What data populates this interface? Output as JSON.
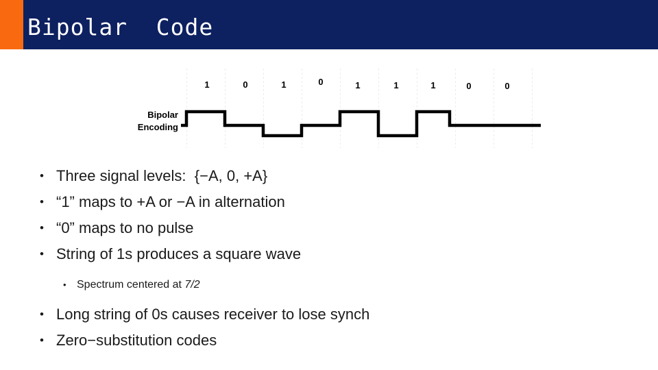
{
  "slide": {
    "title": "Bipolar  Code",
    "accent_color": "#f96a10",
    "header_color": "#0d2060",
    "title_color": "#ffffff"
  },
  "diagram": {
    "axis_label_line1": "Bipolar",
    "axis_label_line2": "Encoding",
    "bits": [
      "1",
      "0",
      "1",
      "0",
      "1",
      "1",
      "1",
      "0",
      "0"
    ],
    "signal": {
      "description": "bipolar AMI waveform",
      "levels": [
        "+A",
        "0",
        "-A",
        "0",
        "+A",
        "-A",
        "+A",
        "0",
        "0"
      ]
    }
  },
  "body": {
    "bullets": [
      "Three signal levels:  {−A, 0, +A}",
      "“1” maps to +A or −A in alternation",
      "“0” maps to no pulse",
      "String of 1s produces a square wave"
    ],
    "sub_bullet_prefix": "Spectrum centered at ",
    "sub_bullet_term": "7/2",
    "bullets_tail": [
      "Long string of 0s causes receiver to lose synch",
      "Zero−substitution codes"
    ]
  }
}
